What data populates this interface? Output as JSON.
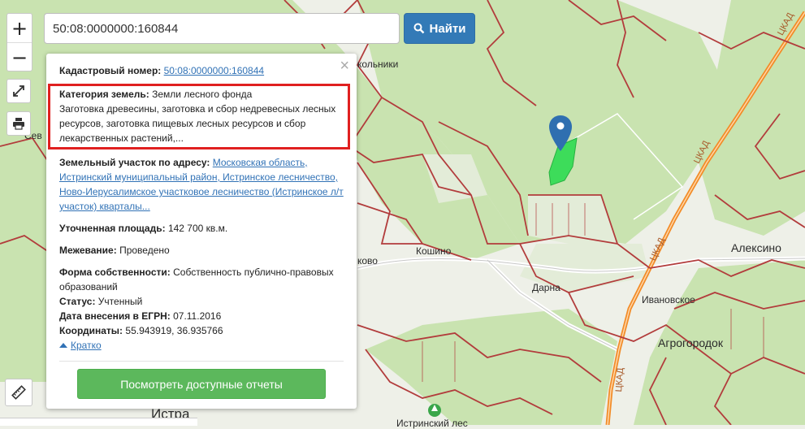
{
  "search": {
    "value": "50:08:0000000:160844",
    "button_label": "Найти"
  },
  "zoom": {
    "in_label": "+",
    "out_label": "−"
  },
  "popup": {
    "cadastral_label": "Кадастровый номер:",
    "cadastral_value": "50:08:0000000:160844",
    "category_label": "Категория земель:",
    "category_value": "Земли лесного фонда",
    "category_desc": "Заготовка древесины, заготовка и сбор недревесных лесных ресурсов, заготовка пищевых лесных ресурсов и сбор лекарственных растений,...",
    "address_label": "Земельный участок по адресу:",
    "address_value": "Московская область, Истринский муниципальный район, Истринское лесничество, Ново-Иерусалимское участковое лесничество (Истринское л/т участок) кварталы...",
    "area_label": "Уточненная площадь:",
    "area_value": "142 700 кв.м.",
    "survey_label": "Межевание:",
    "survey_value": "Проведено",
    "ownership_label": "Форма собственности:",
    "ownership_value": "Собственность публично-правовых образований",
    "status_label": "Статус:",
    "status_value": "Учтенный",
    "date_label": "Дата внесения в ЕГРН:",
    "date_value": "07.11.2016",
    "coords_label": "Координаты:",
    "coords_value": "55.943919, 36.935766",
    "toggle_label": "Кратко",
    "reports_button": "Посмотреть доступные отчеты",
    "close_glyph": "×"
  },
  "map": {
    "labels": [
      "Сев",
      "Кошино",
      "Дарна",
      "Алексино",
      "Ивановское",
      "Агрогородок",
      "Истра",
      "Истринский лес",
      "кольники",
      "ково"
    ],
    "road_label": "ЦКАД",
    "colors": {
      "forest": "#c9e3b0",
      "open": "#eef0e8",
      "boundary": "#b23c3c",
      "road": "#f28c28",
      "parcel": "#3ddc5a",
      "marker": "#2f6fb0"
    }
  }
}
